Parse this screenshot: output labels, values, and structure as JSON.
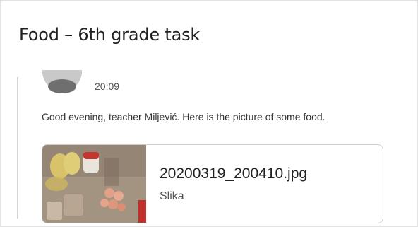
{
  "header": {
    "title": "Food – 6th grade task"
  },
  "post": {
    "avatar_icon": "user-avatar-icon",
    "time": "20:09",
    "message": "Good evening, teacher Miljević. Here is the picture of some food."
  },
  "attachment": {
    "file_name": "20200319_200410.jpg",
    "file_type": "Slika",
    "thumbnail_icon": "food-photo-thumbnail"
  },
  "colors": {
    "title_text": "#222222",
    "border": "#cfcfcf",
    "thread_line": "#d6d6d6"
  }
}
